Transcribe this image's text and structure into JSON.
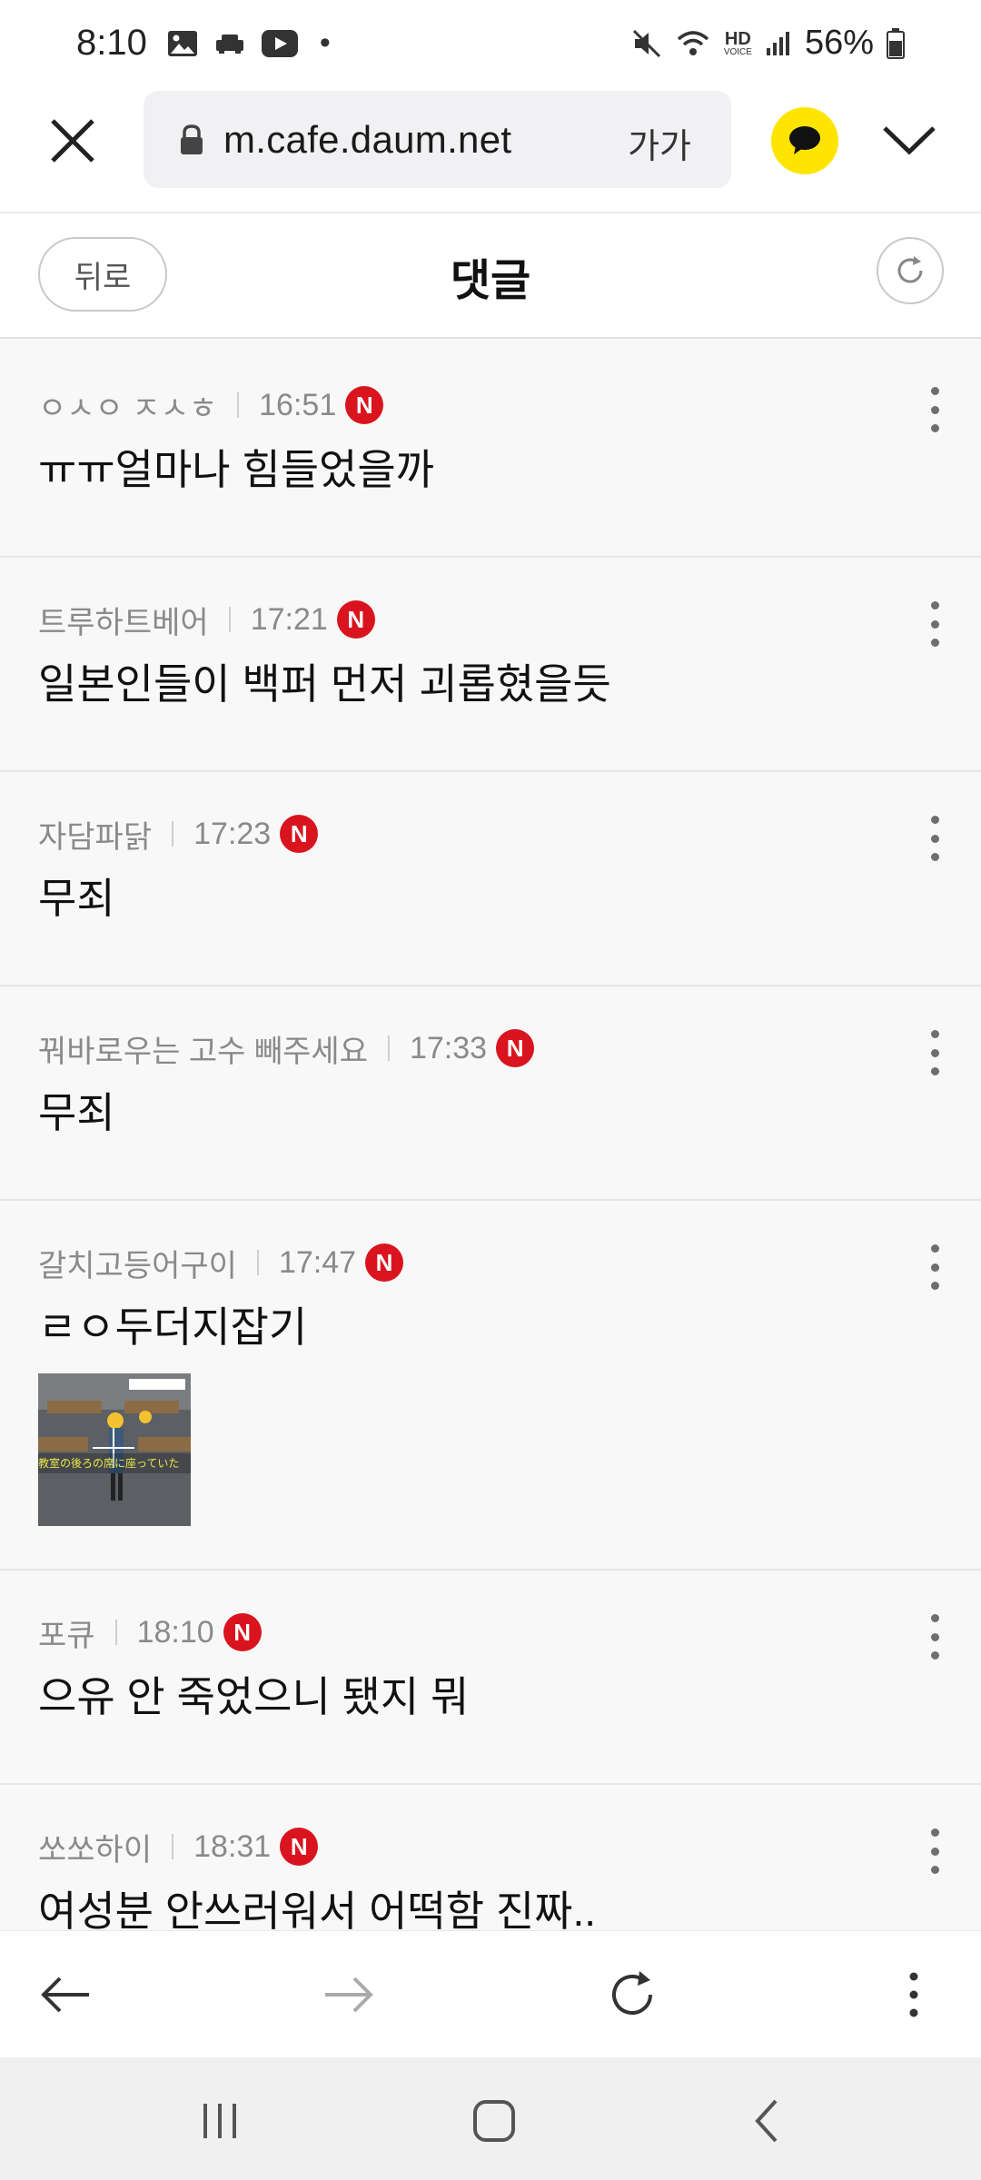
{
  "status_bar": {
    "time": "8:10",
    "dot": "•",
    "battery": "56%",
    "icons_left": [
      "gallery-icon",
      "car-icon",
      "youtube-icon"
    ],
    "icons_right": [
      "mute-icon",
      "wifi-icon",
      "hd-voice-icon",
      "signal-icon",
      "battery-icon"
    ],
    "hd_label": "HD",
    "voice_label": "VOICE"
  },
  "browser": {
    "url": "m.cafe.daum.net",
    "font_size_label": "가가",
    "kakao_color": "#FEE500"
  },
  "header": {
    "back_label": "뒤로",
    "title": "댓글"
  },
  "new_badge_label": "N",
  "comments": [
    {
      "author": "ㅇㅅㅇ ㅈㅅㅎ",
      "time": "16:51",
      "text": "ㅠㅠ얼마나 힘들었을까"
    },
    {
      "author": "트루하트베어",
      "time": "17:21",
      "text": "일본인들이 백퍼 먼저 괴롭혔을듯"
    },
    {
      "author": "자담파닭",
      "time": "17:23",
      "text": "무죄"
    },
    {
      "author": "꿔바로우는 고수 빼주세요",
      "time": "17:33",
      "text": "무죄"
    },
    {
      "author": "갈치고등어구이",
      "time": "17:47",
      "text": "ㄹㅇ두더지잡기",
      "image_text": "教室の後ろの席に座っていた"
    },
    {
      "author": "포큐",
      "time": "18:10",
      "text": "으유 안 죽었으니 됐지 뭐"
    },
    {
      "author": "쏘쏘하이",
      "time": "18:31",
      "text": "여성분 안쓰러워서 어떡함 진짜.."
    }
  ],
  "colors": {
    "new_badge": "#d9141e",
    "accent_yellow": "#FEE500"
  }
}
